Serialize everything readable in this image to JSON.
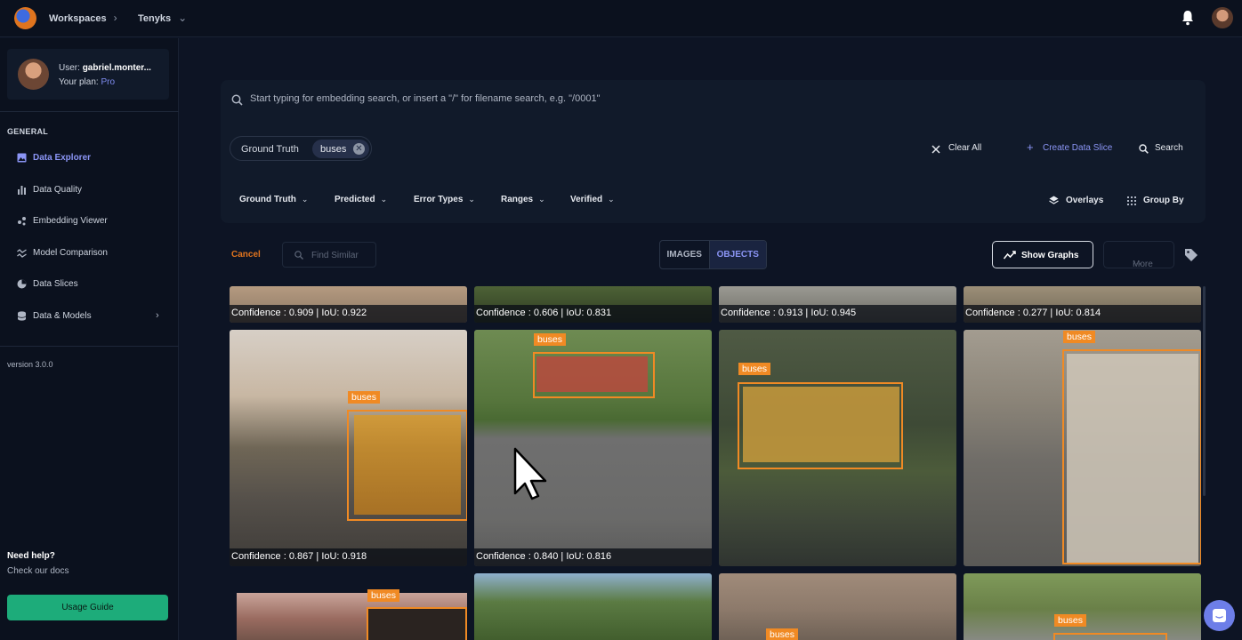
{
  "topbar": {
    "workspaces_label": "Workspaces",
    "project_label": "Tenyks"
  },
  "sidebar": {
    "user_prefix": "User:",
    "user_name": "gabriel.monter...",
    "plan_prefix": "Your plan:",
    "plan_name": "Pro",
    "section_heading": "GENERAL",
    "items": [
      {
        "label": "Data Explorer",
        "icon": "image-icon",
        "active": true
      },
      {
        "label": "Data Quality",
        "icon": "bar-chart-icon",
        "active": false
      },
      {
        "label": "Embedding Viewer",
        "icon": "scatter-icon",
        "active": false
      },
      {
        "label": "Model Comparison",
        "icon": "compare-icon",
        "active": false
      },
      {
        "label": "Data Slices",
        "icon": "pie-icon",
        "active": false
      },
      {
        "label": "Data & Models",
        "icon": "database-icon",
        "active": false
      }
    ],
    "version": "version 3.0.0",
    "help_title": "Need help?",
    "help_sub": "Check our docs",
    "usage_guide": "Usage Guide"
  },
  "search": {
    "placeholder": "Start typing for embedding search, or insert a \"/\" for filename search, e.g. \"/0001\"",
    "chip_label": "Ground Truth",
    "chip_value": "buses",
    "clear_all": "Clear All",
    "create_slice": "Create Data Slice",
    "search_btn": "Search",
    "filters": [
      "Ground Truth",
      "Predicted",
      "Error Types",
      "Ranges",
      "Verified"
    ],
    "overlays": "Overlays",
    "group_by": "Group By"
  },
  "toolbar": {
    "cancel": "Cancel",
    "find_similar": "Find Similar",
    "tab_images": "IMAGES",
    "tab_objects": "OBJECTS",
    "show_graphs": "Show Graphs",
    "more": "More"
  },
  "cards": {
    "row1": [
      "Confidence : 0.909 | IoU: 0.922",
      "Confidence : 0.606 | IoU: 0.831",
      "Confidence : 0.913 | IoU: 0.945",
      "Confidence : 0.277 | IoU: 0.814"
    ],
    "row2": [
      "Confidence : 0.867 | IoU: 0.918",
      "Confidence : 0.840 | IoU: 0.816"
    ],
    "box_label": "buses"
  },
  "colors": {
    "accent": "#8b95f5",
    "cancel": "#e0741e",
    "bbox": "#f08a24",
    "usage_button": "#1dac7a"
  }
}
